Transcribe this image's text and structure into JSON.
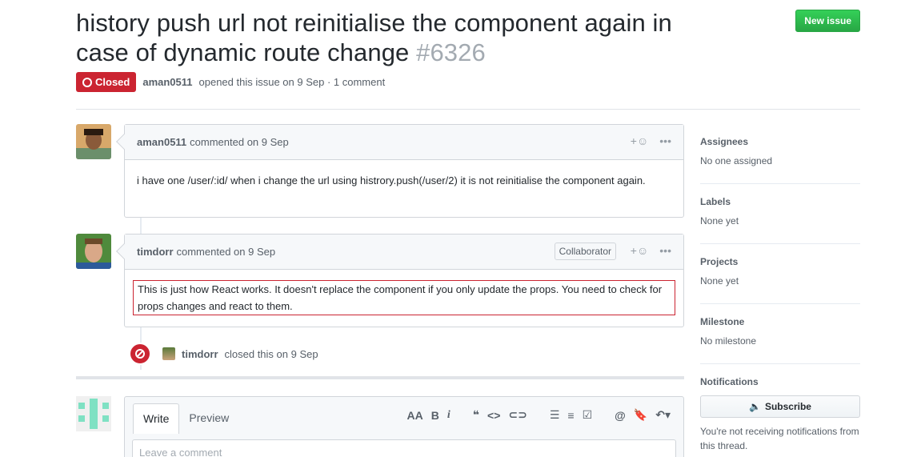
{
  "issue": {
    "title": "history push url not reinitialise the component again in case of dynamic route change",
    "number": "#6326",
    "status": "Closed",
    "author": "aman0511",
    "opened_text": "opened this issue on 9 Sep · 1 comment",
    "new_issue_label": "New issue"
  },
  "comments": [
    {
      "author": "aman0511",
      "meta": "commented on 9 Sep",
      "body": "i have one /user/:id/ when i change the url using histrory.push(/user/2) it is not reinitialise the component again."
    },
    {
      "author": "timdorr",
      "meta": "commented on 9 Sep",
      "role": "Collaborator",
      "body": "This is just how React works. It doesn't replace the component if you only update the props. You need to check for props changes and react to them."
    }
  ],
  "event": {
    "actor": "timdorr",
    "text": "closed this on 9 Sep"
  },
  "composer": {
    "tab_write": "Write",
    "tab_preview": "Preview",
    "placeholder": "Leave a comment"
  },
  "sidebar": {
    "assignees_title": "Assignees",
    "assignees_value": "No one assigned",
    "labels_title": "Labels",
    "labels_value": "None yet",
    "projects_title": "Projects",
    "projects_value": "None yet",
    "milestone_title": "Milestone",
    "milestone_value": "No milestone",
    "notifications_title": "Notifications",
    "subscribe_label": "Subscribe",
    "notifications_note": "You're not receiving notifications from this thread."
  },
  "colors": {
    "closed_red": "#cb2431",
    "new_issue_green": "#2cbe4e"
  }
}
